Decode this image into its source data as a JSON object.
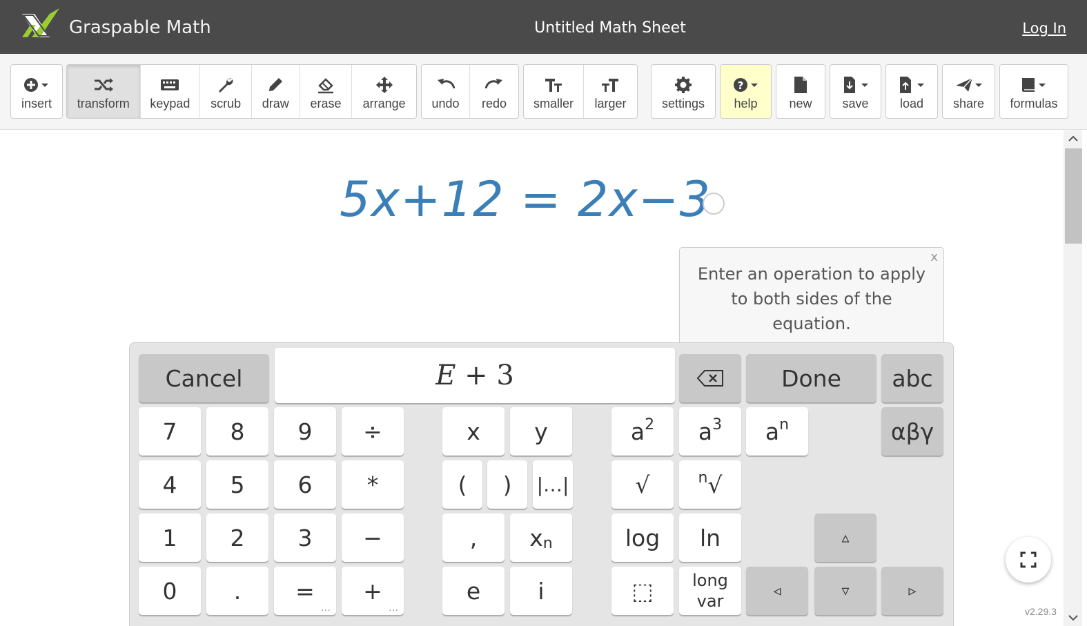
{
  "header": {
    "brand": "Graspable Math",
    "doc_title": "Untitled Math Sheet",
    "login": "Log In"
  },
  "toolbar": {
    "insert": "insert",
    "transform": "transform",
    "keypad": "keypad",
    "scrub": "scrub",
    "draw": "draw",
    "erase": "erase",
    "arrange": "arrange",
    "undo": "undo",
    "redo": "redo",
    "smaller": "smaller",
    "larger": "larger",
    "settings": "settings",
    "help": "help",
    "new": "new",
    "save": "save",
    "load": "load",
    "share": "share",
    "formulas": "formulas"
  },
  "equation": "5x+12 = 2x−3",
  "tooltip": {
    "text_line1": "Enter an operation to apply",
    "text_line2": "to both sides of the",
    "text_line3": "equation.",
    "close": "x"
  },
  "keypad": {
    "input_var": "E",
    "input_rest": " + 3",
    "cancel": "Cancel",
    "done": "Done",
    "abc": "abc",
    "greek": "αβγ",
    "digits": [
      "7",
      "8",
      "9",
      "4",
      "5",
      "6",
      "1",
      "2",
      "3",
      "0",
      "."
    ],
    "divide": "÷",
    "multiply": "*",
    "minus": "−",
    "equals": "=",
    "plus": "+",
    "x": "x",
    "y": "y",
    "lparen": "(",
    "rparen": ")",
    "abs": "|…|",
    "comma": ",",
    "xn_base": "x",
    "xn_sub": "n",
    "e": "e",
    "i": "i",
    "a": "a",
    "sq_exp": "2",
    "cube_exp": "3",
    "n_exp": "n",
    "sqrt": "√",
    "nroot_index": "n",
    "nroot_sym": "√",
    "log": "log",
    "ln": "ln",
    "placeholder": "⬚",
    "long": "long",
    "var": "var",
    "up": "▵",
    "left": "◃",
    "down": "▿",
    "right": "▹",
    "more": "…"
  },
  "version": "v2.29.3",
  "colors": {
    "header_bg": "#4a4a4a",
    "equation": "#3b7fb8",
    "help_bg": "#ffffcc"
  }
}
